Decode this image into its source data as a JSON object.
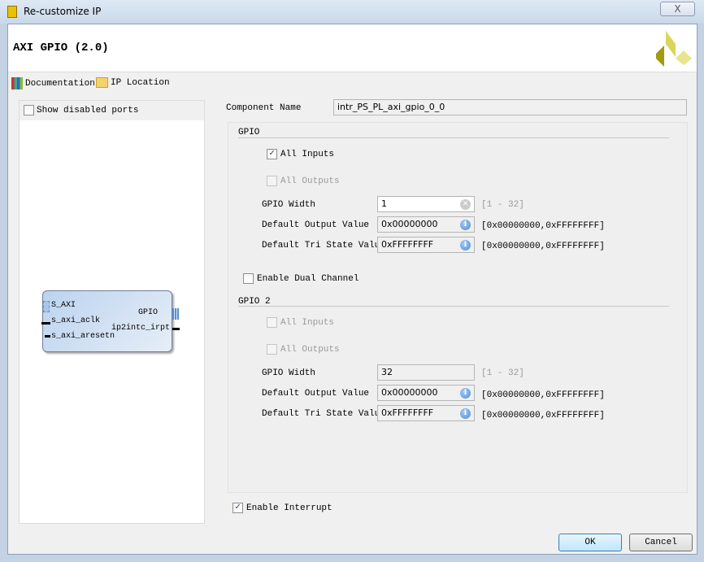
{
  "window": {
    "title": "Re-customize IP",
    "close": "X"
  },
  "header": {
    "ip_title": "AXI GPIO (2.0)"
  },
  "toolbar": {
    "documentation": "Documentation",
    "ip_location": "IP Location"
  },
  "left": {
    "show_disabled_ports": "Show disabled ports",
    "block": {
      "s_axi": "S_AXI",
      "aclk": "s_axi_aclk",
      "aresetn": "s_axi_aresetn",
      "gpio": "GPIO",
      "irpt": "ip2intc_irpt"
    }
  },
  "component": {
    "label": "Component Name",
    "value": "intr_PS_PL_axi_gpio_0_0"
  },
  "gpio": {
    "title": "GPIO",
    "all_inputs": "All Inputs",
    "all_inputs_checked": true,
    "all_outputs": "All Outputs",
    "width_label": "GPIO Width",
    "width_value": "1",
    "width_range": "[1 - 32]",
    "dout_label": "Default Output Value",
    "dout_value": "0x00000000",
    "dout_range": "[0x00000000,0xFFFFFFFF]",
    "tri_label": "Default Tri State Value",
    "tri_value": "0xFFFFFFFF",
    "tri_range": "[0x00000000,0xFFFFFFFF]"
  },
  "dual": {
    "label": "Enable Dual Channel",
    "checked": false
  },
  "gpio2": {
    "title": "GPIO 2",
    "all_inputs": "All Inputs",
    "all_outputs": "All Outputs",
    "width_label": "GPIO Width",
    "width_value": "32",
    "width_range": "[1 - 32]",
    "dout_label": "Default Output Value",
    "dout_value": "0x00000000",
    "dout_range": "[0x00000000,0xFFFFFFFF]",
    "tri_label": "Default Tri State Value",
    "tri_value": "0xFFFFFFFF",
    "tri_range": "[0x00000000,0xFFFFFFFF]"
  },
  "interrupt": {
    "label": "Enable Interrupt",
    "checked": true
  },
  "buttons": {
    "ok": "OK",
    "cancel": "Cancel"
  },
  "check": "✓"
}
